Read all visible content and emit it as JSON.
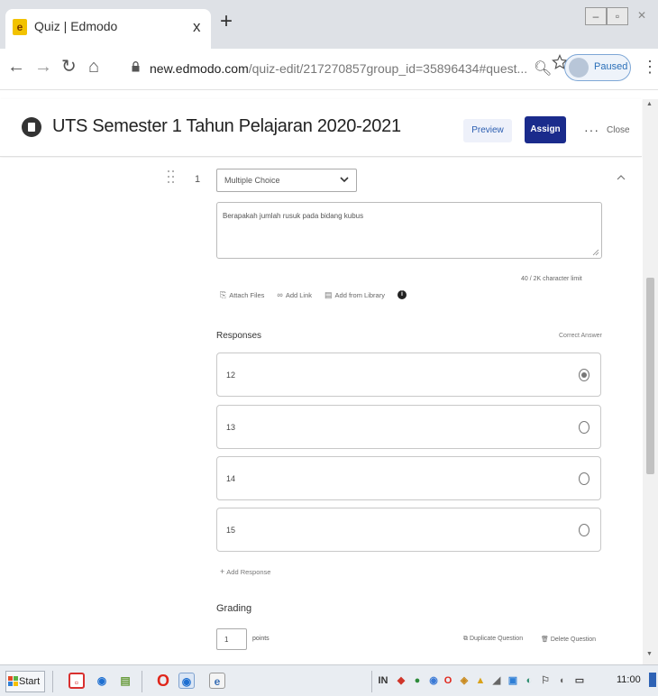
{
  "browser": {
    "tab_title": "Quiz | Edmodo",
    "tab_close": "x",
    "new_tab": "+",
    "favicon_letter": "e",
    "url_host": "new.edmodo.com",
    "url_path": "/quiz-edit/217270857group_id=35896434#quest...",
    "profile_label": "Paused"
  },
  "header": {
    "title": "UTS Semester 1 Tahun Pelajaran 2020-2021",
    "preview_label": "Preview",
    "assign_label": "Assign",
    "close_label": "Close"
  },
  "question": {
    "number": "1",
    "type": "Multiple Choice",
    "text": "Berapakah jumlah rusuk pada bidang kubus",
    "char_limit": "40 / 2K character limit",
    "attach_files": "Attach Files",
    "add_link": "Add Link",
    "add_from_library": "Add from Library",
    "responses_heading": "Responses",
    "correct_answer_heading": "Correct Answer",
    "responses": [
      {
        "value": "12",
        "correct": true
      },
      {
        "value": "13",
        "correct": false
      },
      {
        "value": "14",
        "correct": false
      },
      {
        "value": "15",
        "correct": false
      }
    ],
    "add_response": "Add Response",
    "grading_label": "Grading",
    "points_value": "1",
    "points_label": "points",
    "duplicate_label": "Duplicate Question",
    "delete_label": "Delete Question"
  },
  "taskbar": {
    "start_label": "Start",
    "clock": "11:00"
  },
  "colors": {
    "assign_button": "#1a2b8c",
    "edmodo_favicon": "#f2c200",
    "tab_strip": "#dee1e6"
  }
}
